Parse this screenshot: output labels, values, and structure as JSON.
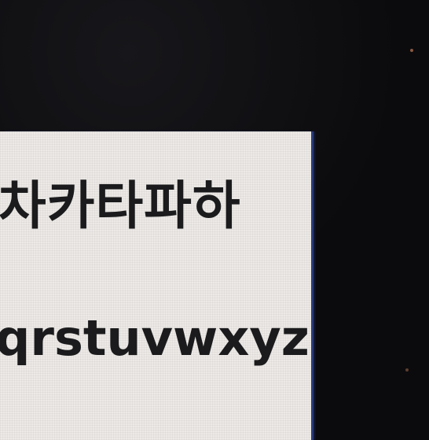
{
  "sample": {
    "korean_line": "차카타파하",
    "latin_line": "qrstuvwxyz"
  }
}
